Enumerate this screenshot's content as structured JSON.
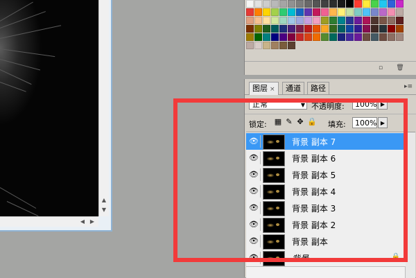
{
  "colors": {
    "workspace": "#a4a5a3",
    "panel": "#d4d0c8",
    "selection": "#3a98f5",
    "highlight": "#f23a3a"
  },
  "swatches": [
    "#f5f5f5",
    "#e1e1e1",
    "#cdcdcd",
    "#b9b9b9",
    "#a5a5a5",
    "#919191",
    "#7d7d7d",
    "#696969",
    "#555555",
    "#414141",
    "#2d2d2d",
    "#191919",
    "#000000",
    "#ff3b30",
    "#ffeb3b",
    "#49d34a",
    "#21c7f0",
    "#2f62d9",
    "#c928c8",
    "#e53935",
    "#ff7f00",
    "#ffd500",
    "#a3d14b",
    "#2ecc71",
    "#00bcd4",
    "#1565c0",
    "#5e35b1",
    "#c2185b",
    "#f06292",
    "#ffb74d",
    "#fff176",
    "#c5e1a5",
    "#80cbc4",
    "#4fc3f7",
    "#7986cb",
    "#ba68c8",
    "#f48fb1",
    "#bcaaa4",
    "#e0a080",
    "#f5c090",
    "#ffe0a0",
    "#d0e8a0",
    "#a0d8c0",
    "#a0c8e8",
    "#a0a8e0",
    "#c8a0e0",
    "#f0a0c0",
    "#9e9d24",
    "#2e7d32",
    "#00838f",
    "#283593",
    "#6a1b9a",
    "#ad1457",
    "#4e342e",
    "#795548",
    "#8d6e63",
    "#5d1e1e",
    "#7a2f00",
    "#7f7f00",
    "#1e5d1e",
    "#005c5c",
    "#1e2f7a",
    "#4a1e7a",
    "#7a1e4a",
    "#b71c1c",
    "#e65100",
    "#f9a825",
    "#33691e",
    "#006064",
    "#0d47a1",
    "#311b92",
    "#880e4f",
    "#3e2723",
    "#263238",
    "#8b0000",
    "#a04000",
    "#9e7b00",
    "#006400",
    "#008080",
    "#000080",
    "#4b0082",
    "#800040",
    "#c62828",
    "#d84315",
    "#ef6c00",
    "#558b2f",
    "#00695c",
    "#1a237e",
    "#4527a0",
    "#6a1b9a",
    "#6d4c41",
    "#455a64",
    "#6d4c41",
    "#8d6e63",
    "#a1887f",
    "#bcaaa4",
    "#d7ccc8",
    "#c8b48a",
    "#a08060",
    "#7a5c3c",
    "#5a4030"
  ],
  "tabs": [
    {
      "label": "图层",
      "close": "×"
    },
    {
      "label": "通道"
    },
    {
      "label": "路径"
    }
  ],
  "panel_menu_icon": "▸≡",
  "blend": {
    "mode": "正常",
    "opacity_label": "不透明度:",
    "opacity_value": "100%"
  },
  "lock": {
    "label": "锁定:",
    "fill_label": "填充:",
    "fill_value": "100%"
  },
  "layers": [
    {
      "name": "背景 副本 7",
      "selected": true
    },
    {
      "name": "背景 副本 6"
    },
    {
      "name": "背景 副本 5"
    },
    {
      "name": "背景 副本 4"
    },
    {
      "name": "背景 副本 3"
    },
    {
      "name": "背景 副本 2"
    },
    {
      "name": "背景 副本"
    },
    {
      "name": "背景",
      "locked": true
    }
  ],
  "icons": {
    "eye": "👁",
    "lock": "🔒",
    "up": "▲",
    "down": "▼",
    "left": "◀",
    "right": "▶",
    "new": "▫",
    "trash": "🗑"
  }
}
